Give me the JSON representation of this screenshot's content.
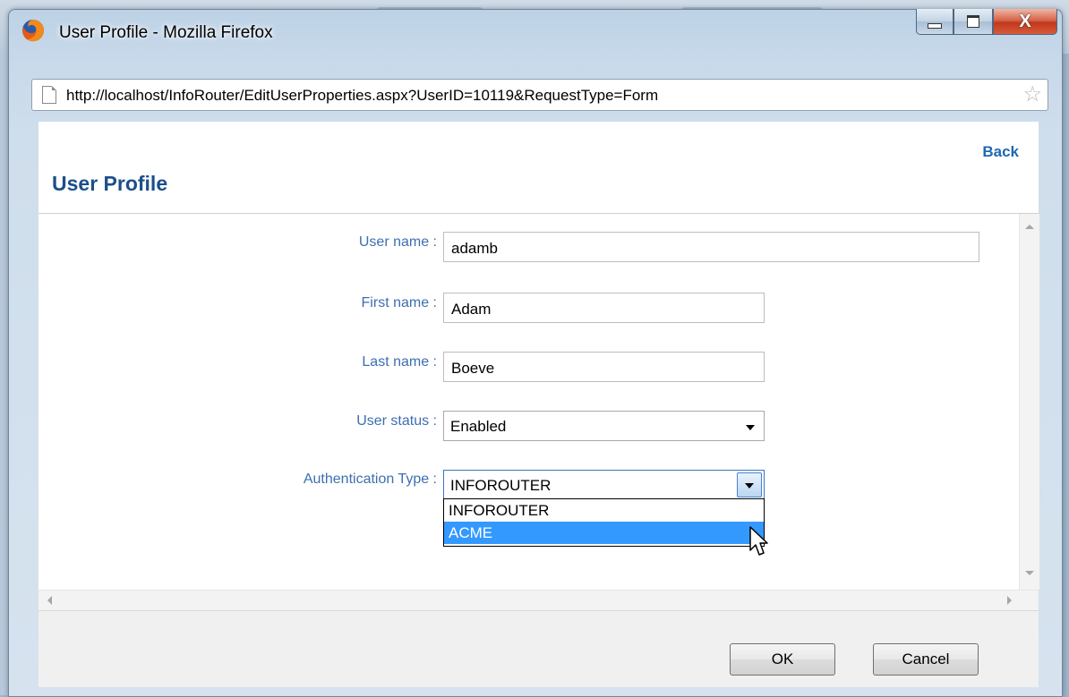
{
  "window": {
    "title": "User Profile - Mozilla Firefox",
    "url": "http://localhost/InfoRouter/EditUserProperties.aspx?UserID=10119&RequestType=Form",
    "close_glyph": "X"
  },
  "page": {
    "back_link": "Back",
    "title": "User Profile"
  },
  "form": {
    "username_label": "User name :",
    "username_value": "adamb",
    "firstname_label": "First name :",
    "firstname_value": "Adam",
    "lastname_label": "Last name :",
    "lastname_value": "Boeve",
    "status_label": "User status :",
    "status_value": "Enabled",
    "auth_label": "Authentication Type :",
    "auth_value": "INFOROUTER",
    "auth_options": [
      "INFOROUTER",
      "ACME"
    ],
    "auth_highlighted": "ACME"
  },
  "footer": {
    "ok_label": "OK",
    "cancel_label": "Cancel"
  },
  "icons": {
    "browser": "firefox-icon",
    "page": "page-icon",
    "bookmark": "star-icon",
    "cursor": "mouse-pointer-icon"
  },
  "colors": {
    "label_blue": "#3d6fb0",
    "title_blue": "#1b4f8a",
    "link_blue": "#1f67b1",
    "highlight": "#3399ff"
  }
}
